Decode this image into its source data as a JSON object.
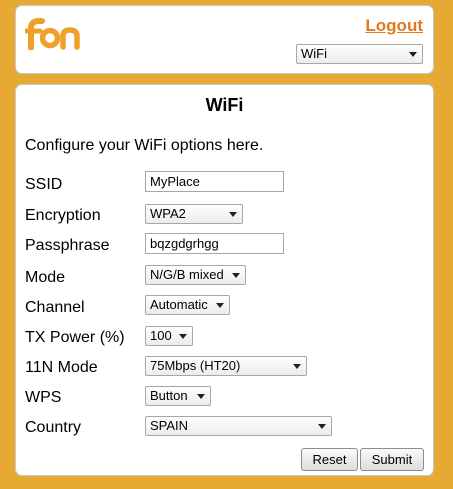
{
  "header": {
    "logo_text": "fon",
    "logout_label": "Logout",
    "page_select": {
      "selected": "WiFi"
    }
  },
  "main": {
    "title": "WiFi",
    "intro": "Configure your WiFi options here.",
    "fields": {
      "ssid": {
        "label": "SSID",
        "value": "MyPlace"
      },
      "encryption": {
        "label": "Encryption",
        "value": "WPA2"
      },
      "passphrase": {
        "label": "Passphrase",
        "value": "bqzgdgrhgg"
      },
      "mode": {
        "label": "Mode",
        "value": "N/G/B mixed"
      },
      "channel": {
        "label": "Channel",
        "value": "Automatic"
      },
      "tx_power": {
        "label": "TX Power (%)",
        "value": "100"
      },
      "n_mode": {
        "label": "11N Mode",
        "value": "75Mbps (HT20)"
      },
      "wps": {
        "label": "WPS",
        "value": "Button"
      },
      "country": {
        "label": "Country",
        "value": "SPAIN"
      }
    },
    "reset_label": "Reset",
    "submit_label": "Submit"
  },
  "colors": {
    "background": "#e5a934",
    "accent": "#e07a1c",
    "panel": "#ffffff"
  }
}
